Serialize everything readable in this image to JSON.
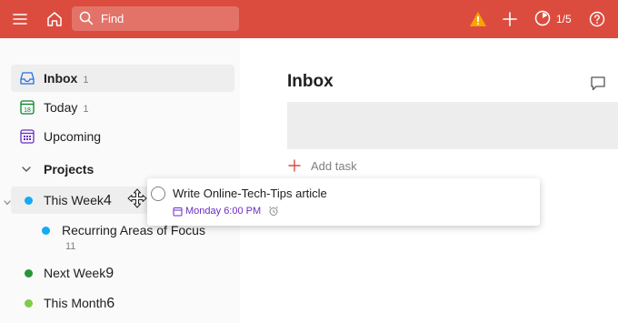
{
  "topbar": {
    "search_placeholder": "Find",
    "karma_progress": "1/5",
    "bg_color": "#db4c3f",
    "icons": [
      "menu-icon",
      "home-icon",
      "search-icon",
      "warning-icon",
      "plus-icon",
      "productivity-icon",
      "help-icon"
    ]
  },
  "sidebar": {
    "nav": [
      {
        "label": "Inbox",
        "count": "1",
        "icon": "inbox-icon"
      },
      {
        "label": "Today",
        "count": "1",
        "icon": "calendar-today-icon",
        "icon_text": "18"
      },
      {
        "label": "Upcoming",
        "count": "",
        "icon": "calendar-upcoming-icon"
      }
    ],
    "projects_label": "Projects",
    "projects": [
      {
        "label": "This Week",
        "count": "4",
        "color": "#14aaf5"
      },
      {
        "label": "Recurring Areas of Focus",
        "count": "11",
        "color": "#14aaf5"
      },
      {
        "label": "Next Week",
        "count": "9",
        "color": "#299438"
      },
      {
        "label": "This Month",
        "count": "6",
        "color": "#7ecc49"
      }
    ]
  },
  "main": {
    "title": "Inbox",
    "add_task_label": "Add task"
  },
  "drag_task": {
    "title": "Write Online-Tech-Tips article",
    "due": "Monday 6:00 PM",
    "due_color": "#692ec2"
  }
}
